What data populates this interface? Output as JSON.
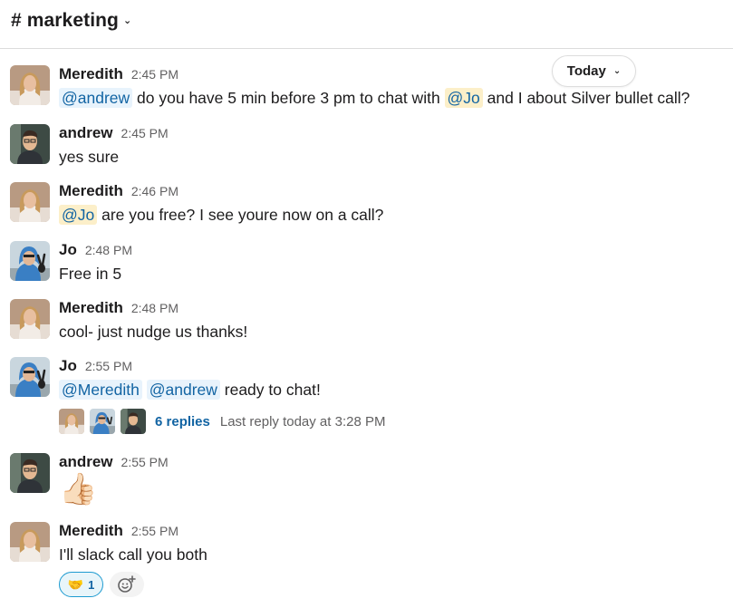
{
  "channel": {
    "name": "# marketing",
    "chevron": "chevron-down-icon"
  },
  "day_divider": {
    "label": "Today"
  },
  "messages": [
    {
      "author": "Meredith",
      "time": "2:45 PM",
      "parts": [
        {
          "mention": "@andrew"
        },
        {
          "text": " do you have 5 min before 3 pm to chat with "
        },
        {
          "mention": "@Jo",
          "self": true
        },
        {
          "text": " and I about Silver bullet call?"
        }
      ]
    },
    {
      "author": "andrew",
      "time": "2:45 PM",
      "text": "yes sure"
    },
    {
      "author": "Meredith",
      "time": "2:46 PM",
      "parts": [
        {
          "mention": "@Jo",
          "self": true
        },
        {
          "text": " are you free? I see youre now on a call?"
        }
      ]
    },
    {
      "author": "Jo",
      "time": "2:48 PM",
      "text": "Free in 5"
    },
    {
      "author": "Meredith",
      "time": "2:48 PM",
      "text": "cool- just nudge us thanks!"
    },
    {
      "author": "Jo",
      "time": "2:55 PM",
      "parts": [
        {
          "mention": "@Meredith"
        },
        {
          "text": " "
        },
        {
          "mention": "@andrew"
        },
        {
          "text": " ready to chat!"
        }
      ],
      "thread": {
        "replies": "6 replies",
        "last_reply": "Last reply today at 3:28 PM"
      }
    },
    {
      "author": "andrew",
      "time": "2:55 PM",
      "emoji": "👍🏻"
    },
    {
      "author": "Meredith",
      "time": "2:55 PM",
      "text": "I'll slack call you both",
      "reaction": {
        "emoji": "🤝",
        "count": "1"
      }
    }
  ],
  "colors": {
    "link": "#1264a3",
    "mention_bg": "#e8f3fc",
    "self_mention_bg": "#fcefc9",
    "reaction_border": "#1d9bd1"
  }
}
